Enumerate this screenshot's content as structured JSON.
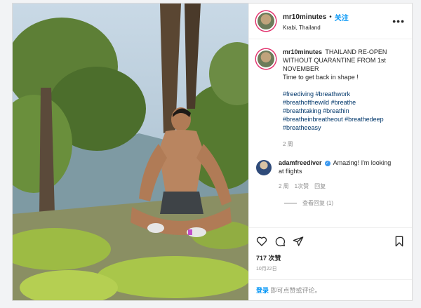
{
  "header": {
    "username": "mr10minutes",
    "separator": "•",
    "follow_label": "关注",
    "location": "Krabi, Thailand",
    "more_icon": "•••"
  },
  "caption": {
    "username": "mr10minutes",
    "text": "THAILAND RE-OPEN WITHOUT QUARANTINE FROM 1st NOVEMBER",
    "line2": "Time to get back in shape !",
    "hashtags": [
      "#freediving",
      "#breathwork",
      "#breathofthewild",
      "#breathe",
      "#breathtaking",
      "#breathin",
      "#breatheinbreatheout",
      "#breathedeep",
      "#breatheeasy"
    ],
    "time": "2 周"
  },
  "comment": {
    "username": "adamfreediver",
    "verified_mark": "✓",
    "text": "Amazing! I'm looking at flights",
    "time": "2 周",
    "likes": "1次赞",
    "reply": "回复",
    "view_replies": "查看回复 (1)"
  },
  "actions": {
    "icons": [
      "heart-icon",
      "comment-icon",
      "share-icon",
      "bookmark-icon"
    ]
  },
  "likes": "717 次赞",
  "date": "10月22日",
  "login": {
    "link": "登录",
    "text": " 即可点赞或评论。"
  },
  "colors": {
    "link_blue": "#0095f6",
    "hashtag": "#00376b",
    "muted": "#8e8e8e"
  }
}
